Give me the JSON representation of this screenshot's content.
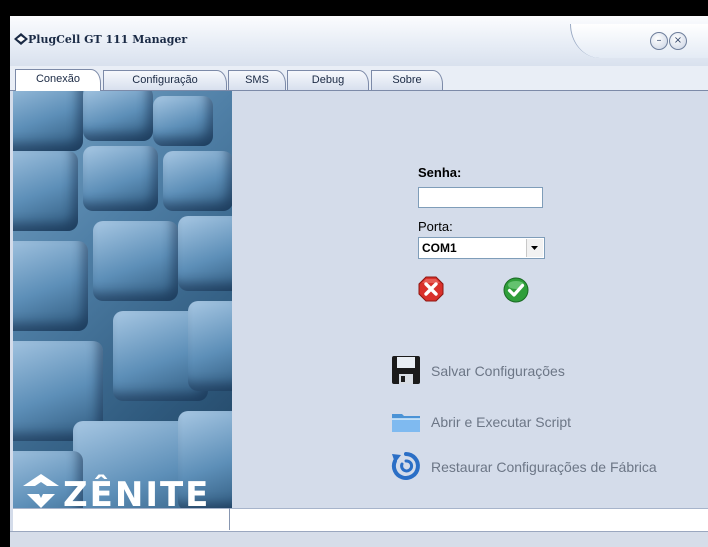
{
  "window": {
    "title": "PlugCell GT 111 Manager",
    "minimize_glyph": "–",
    "close_glyph": "×"
  },
  "tabs": [
    {
      "label": "Conexão",
      "active": true
    },
    {
      "label": "Configuração",
      "active": false
    },
    {
      "label": "SMS",
      "active": false
    },
    {
      "label": "Debug",
      "active": false
    },
    {
      "label": "Sobre",
      "active": false
    }
  ],
  "form": {
    "senha_label": "Senha:",
    "senha_value": "",
    "porta_label": "Porta:",
    "porta_value": "COM1"
  },
  "actions": {
    "save": "Salvar Configurações",
    "open": "Abrir e Executar Script",
    "restore": "Restaurar Configurações de Fábrica"
  },
  "branding": {
    "logo_text": "ZÊNITE"
  },
  "colors": {
    "accent": "#1a2a45",
    "cancel": "#d9302b",
    "ok": "#2f9e3a",
    "disabled_text": "#6c7686"
  }
}
